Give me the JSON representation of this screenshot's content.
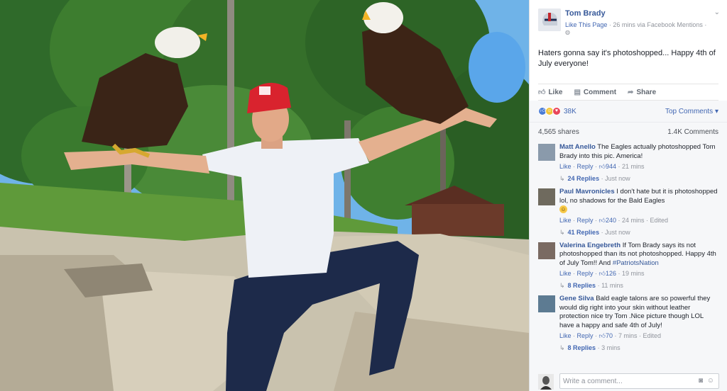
{
  "post": {
    "page_name": "Tom Brady",
    "like_page": "Like This Page",
    "meta_rest": " · 26 mins via Facebook Mentions ·",
    "text": "Haters gonna say it's photoshopped... Happy 4th of July everyone!"
  },
  "actions": {
    "like": "Like",
    "comment": "Comment",
    "share": "Share"
  },
  "reactions": {
    "count": "38K",
    "top_comments": "Top Comments"
  },
  "stats": {
    "shares": "4,565 shares",
    "comments": "1.4K Comments"
  },
  "comments": [
    {
      "name": "Matt Anello",
      "text": " The Eagles actually photoshopped Tom Brady into this pic. America!",
      "likes": "944",
      "time": "21 mins",
      "edited": "",
      "replies": "24 Replies",
      "replies_time": "Just now"
    },
    {
      "name": "Paul Mavronicles",
      "text": " I don't hate but it is photoshopped lol, no shadows for the Bald Eagles",
      "likes": "240",
      "time": "24 mins",
      "edited": " · Edited",
      "replies": "41 Replies",
      "replies_time": "Just now"
    },
    {
      "name": "Valerina Engebreth",
      "text": " If Tom Brady says its not photoshopped than its not photoshopped. Happy 4th of July Tom!! And ",
      "tag": "#PatriotsNation",
      "likes": "126",
      "time": "19 mins",
      "edited": "",
      "replies": "8 Replies",
      "replies_time": "11 mins"
    },
    {
      "name": "Gene Silva",
      "text": " Bald eagle talons are so powerful they would dig right into your skin without leather protection nice try Tom .Nice picture though LOL have a happy and safe 4th of July!",
      "likes": "70",
      "time": "7 mins",
      "edited": " · Edited",
      "replies": "8 Replies",
      "replies_time": "3 mins"
    }
  ],
  "comment_footer": {
    "like": "Like",
    "reply": "Reply"
  },
  "composer": {
    "placeholder": "Write a comment..."
  },
  "colors": {
    "link": "#365899",
    "accent": "#4267b2",
    "muted": "#90949c",
    "panel_bg": "#f6f7f9"
  },
  "icons": {
    "like": "thumbs-up-icon",
    "comment": "speech-bubble-icon",
    "share": "share-arrow-icon",
    "globe": "globe-icon",
    "chevron": "chevron-down-icon",
    "camera": "camera-icon",
    "emoji": "smiley-icon"
  }
}
